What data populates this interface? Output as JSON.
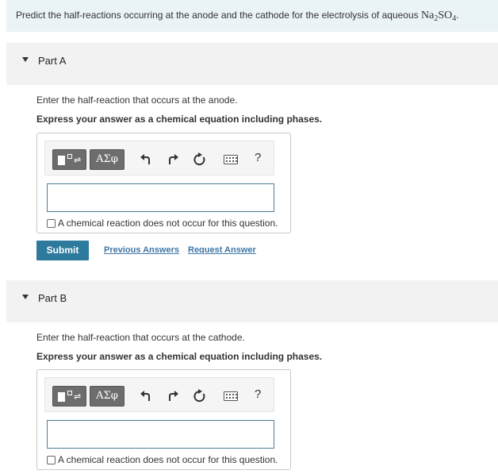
{
  "question": {
    "prefix": "Predict the half-reactions occurring at the anode and the cathode for the electrolysis of aqueous ",
    "formula_parts": [
      "Na",
      "2",
      "SO",
      "4"
    ],
    "suffix": "."
  },
  "toolbar": {
    "templates_icon": "templates-icon",
    "greek_label": "ΑΣφ",
    "undo_icon": "undo-icon",
    "redo_icon": "redo-icon",
    "reset_icon": "reset-icon",
    "keyboard_icon": "keyboard-icon",
    "help_label": "?"
  },
  "parts": [
    {
      "title": "Part A",
      "prompt": "Enter the half-reaction that occurs at the anode.",
      "instruction": "Express your answer as a chemical equation including phases.",
      "answer_value": "",
      "no_reaction_label": "A chemical reaction does not occur for this question.",
      "submit_label": "Submit",
      "previous_answers_label": "Previous Answers",
      "request_answer_label": "Request Answer"
    },
    {
      "title": "Part B",
      "prompt": "Enter the half-reaction that occurs at the cathode.",
      "instruction": "Express your answer as a chemical equation including phases.",
      "answer_value": "",
      "no_reaction_label": "A chemical reaction does not occur for this question."
    }
  ],
  "colors": {
    "submit": "#2d7a9c",
    "link": "#3f76a6",
    "header_bg": "#f2f2f2",
    "intro_bg": "#eaf3f5"
  }
}
